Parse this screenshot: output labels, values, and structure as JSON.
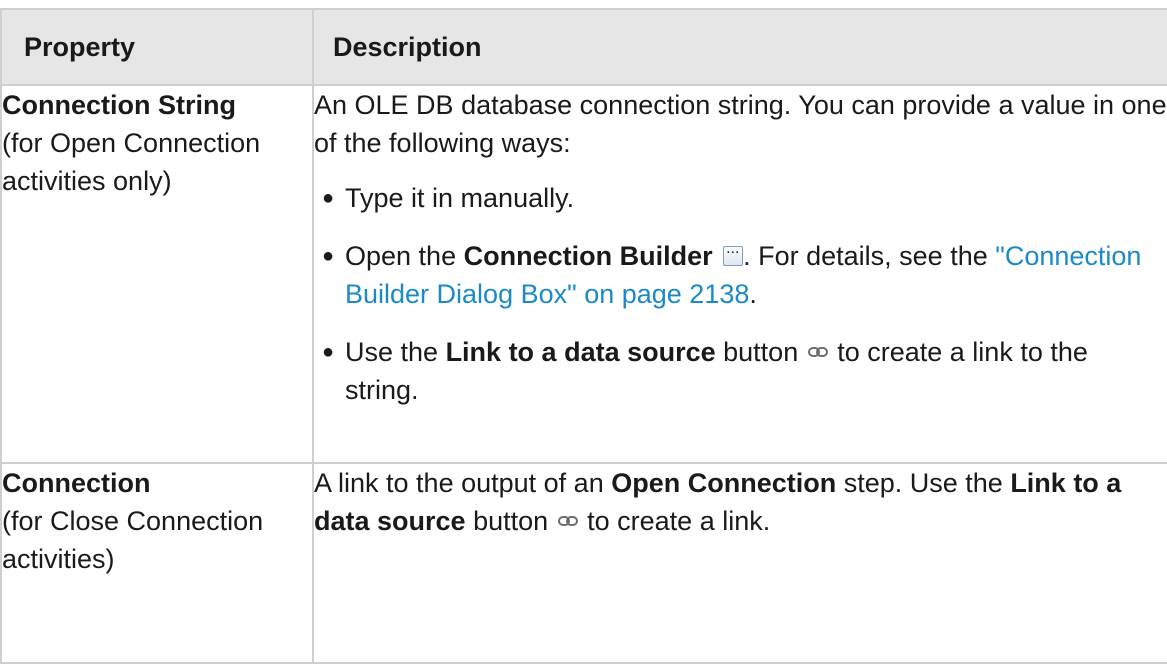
{
  "header": {
    "property": "Property",
    "description": "Description"
  },
  "rows": [
    {
      "property_name": "Connection String",
      "property_note": "(for Open Connection activities only)",
      "description_intro": "An OLE DB database connection string. You can provide a value in one of the following ways:",
      "items": [
        {
          "text": "Type it in manually."
        },
        {
          "pre": "Open the ",
          "bold": "Connection Builder",
          "icon": "ellipsis-button-icon",
          "mid": ". For details, see the ",
          "link": "\"Connection Builder Dialog Box\" on page 2138",
          "post": "."
        },
        {
          "pre": "Use the ",
          "bold": "Link to a data source",
          "mid": " button ",
          "icon": "chain-link-icon",
          "post": " to create a link to the string."
        }
      ]
    },
    {
      "property_name": "Connection",
      "property_note": "(for Close Connection activities)",
      "desc_pre": "A link to the output of an ",
      "desc_bold1": "Open Connection",
      "desc_mid": " step. Use the ",
      "desc_bold2": "Link to a data source",
      "desc_mid2": " button ",
      "icon": "chain-link-icon",
      "desc_post": " to create a link."
    }
  ],
  "bullet_glyph": "●"
}
